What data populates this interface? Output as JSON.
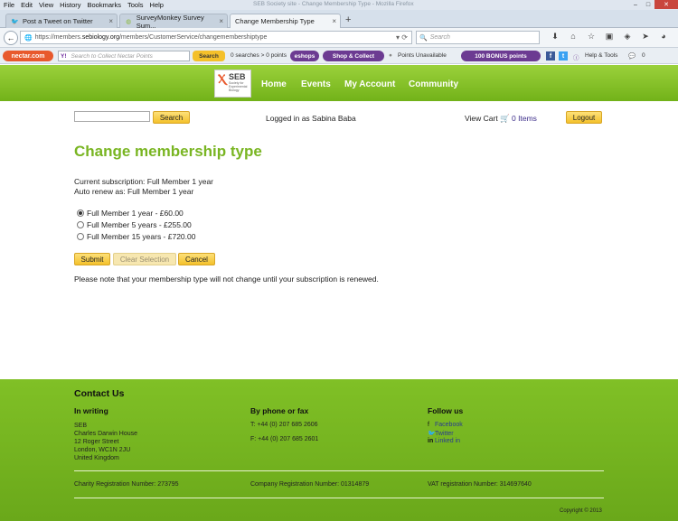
{
  "browser": {
    "menu": [
      "File",
      "Edit",
      "View",
      "History",
      "Bookmarks",
      "Tools",
      "Help"
    ],
    "window_title": "SEB Society site - Change Membership Type - Mozilla Firefox",
    "tabs": [
      {
        "label": "Post a Tweet on Twitter",
        "icon": "twitter-icon"
      },
      {
        "label": "SurveyMonkey Survey Sum...",
        "icon": "surveymonkey-icon"
      },
      {
        "label": "Change Membership Type",
        "icon": "blank-icon"
      }
    ],
    "url_prefix": "https://members.",
    "url_domain": "sebiology.org",
    "url_path": "/members/CustomerService/changemembershiptype",
    "search_placeholder": "Search"
  },
  "toolbar": {
    "nectar_label": "nectar.com",
    "collect_placeholder": "Search to Collect Nectar Points",
    "search_btn": "Search",
    "searches_text": "0 searches > 0 points",
    "eshops": "eshops",
    "shop_collect": "Shop & Collect",
    "points_unavailable": "Points Unavailable",
    "bonus": "100 BONUS points",
    "help_tools": "Help & Tools",
    "msg_count": "0"
  },
  "site": {
    "logo_abbr": "SEB",
    "logo_sub": "Society for Experimental Biology",
    "nav": [
      "Home",
      "Events",
      "My Account",
      "Community"
    ],
    "search_btn": "Search",
    "logged_in": "Logged in as Sabina Baba",
    "view_cart": "View Cart",
    "cart_items": "0 Items",
    "logout": "Logout"
  },
  "main": {
    "title": "Change membership type",
    "current_subscription": "Current subscription: Full Member 1 year",
    "auto_renew": "Auto renew as: Full Member 1 year",
    "options": [
      {
        "label": "Full Member 1 year - £60.00",
        "selected": true
      },
      {
        "label": "Full Member 5 years - £255.00",
        "selected": false
      },
      {
        "label": "Full Member 15 years - £720.00",
        "selected": false
      }
    ],
    "submit": "Submit",
    "clear": "Clear Selection",
    "cancel": "Cancel",
    "note": "Please note that your membership type will not change until your subscription is renewed."
  },
  "footer": {
    "contact": "Contact Us",
    "in_writing": "In writing",
    "address": [
      "SEB",
      "Charles Darwin House",
      "12 Roger Street",
      "London, WC1N 2JU",
      "United Kingdom"
    ],
    "phone_head": "By phone or fax",
    "tel": "T: +44 (0) 207 685 2606",
    "fax": "F: +44 (0) 207 685 2601",
    "follow": "Follow us",
    "social": [
      "Facebook",
      "Twitter",
      "Linked in"
    ],
    "charity": "Charity Registration Number: 273795",
    "company": "Company Registration Number: 01314879",
    "vat": "VAT registration Number: 314697640",
    "copyright": "Copyright © 2013"
  }
}
